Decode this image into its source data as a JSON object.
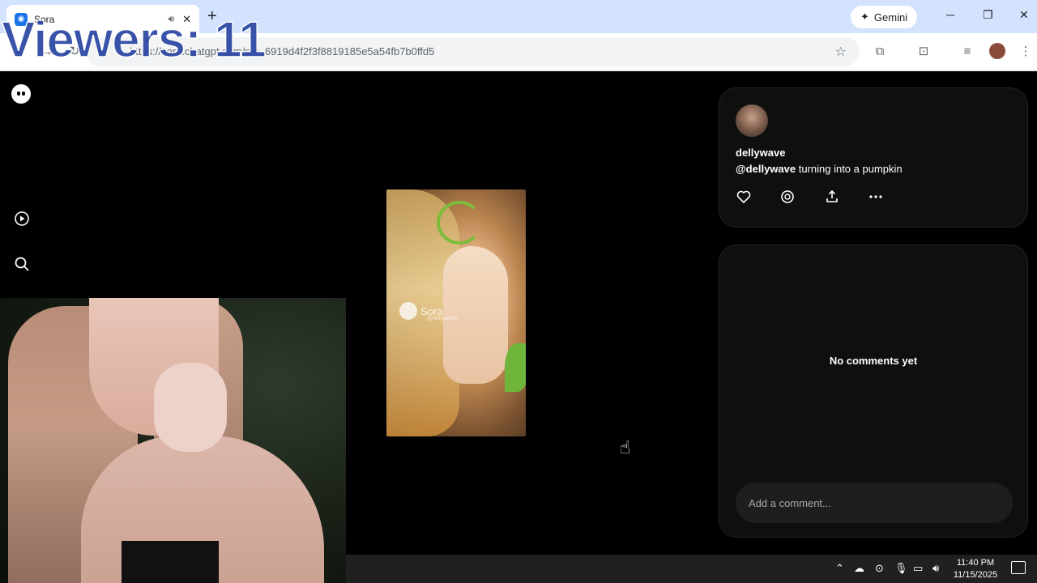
{
  "overlay": {
    "viewers_label": "Viewers: 11"
  },
  "browser": {
    "tab_title": "Sora",
    "tab_favicon": "sora-icon",
    "new_tab": "+",
    "gemini_label": "Gemini",
    "url": "https://sora.chatgpt.com/p/s_6919d4f2f3f8819185e5a54fb7b0ffd5",
    "controls": {
      "minimize": "─",
      "restore": "❐",
      "close": "✕"
    }
  },
  "post": {
    "username": "dellywave",
    "caption_mention": "@dellywave",
    "caption_text": " turning into a pumpkin",
    "watermark_brand": "Sora",
    "watermark_user": "@dellywave",
    "actions": [
      "like-icon",
      "remix-icon",
      "share-icon",
      "more-icon"
    ]
  },
  "comments": {
    "empty_text": "No comments yet",
    "placeholder": "Add a comment..."
  },
  "sidebar": {
    "items": [
      "home-icon",
      "search-icon",
      "trophy-icon",
      "bell-icon",
      "profile-avatar"
    ]
  },
  "taskbar": {
    "time": "11:40 PM",
    "date": "11/15/2025"
  },
  "colors": {
    "viewers_text": "#2e4aa4",
    "tabbar_bg": "#d3e3fd",
    "app_bg": "#000000",
    "panel_bg": "#0f0f0f",
    "taskbar_bg": "#202020"
  }
}
